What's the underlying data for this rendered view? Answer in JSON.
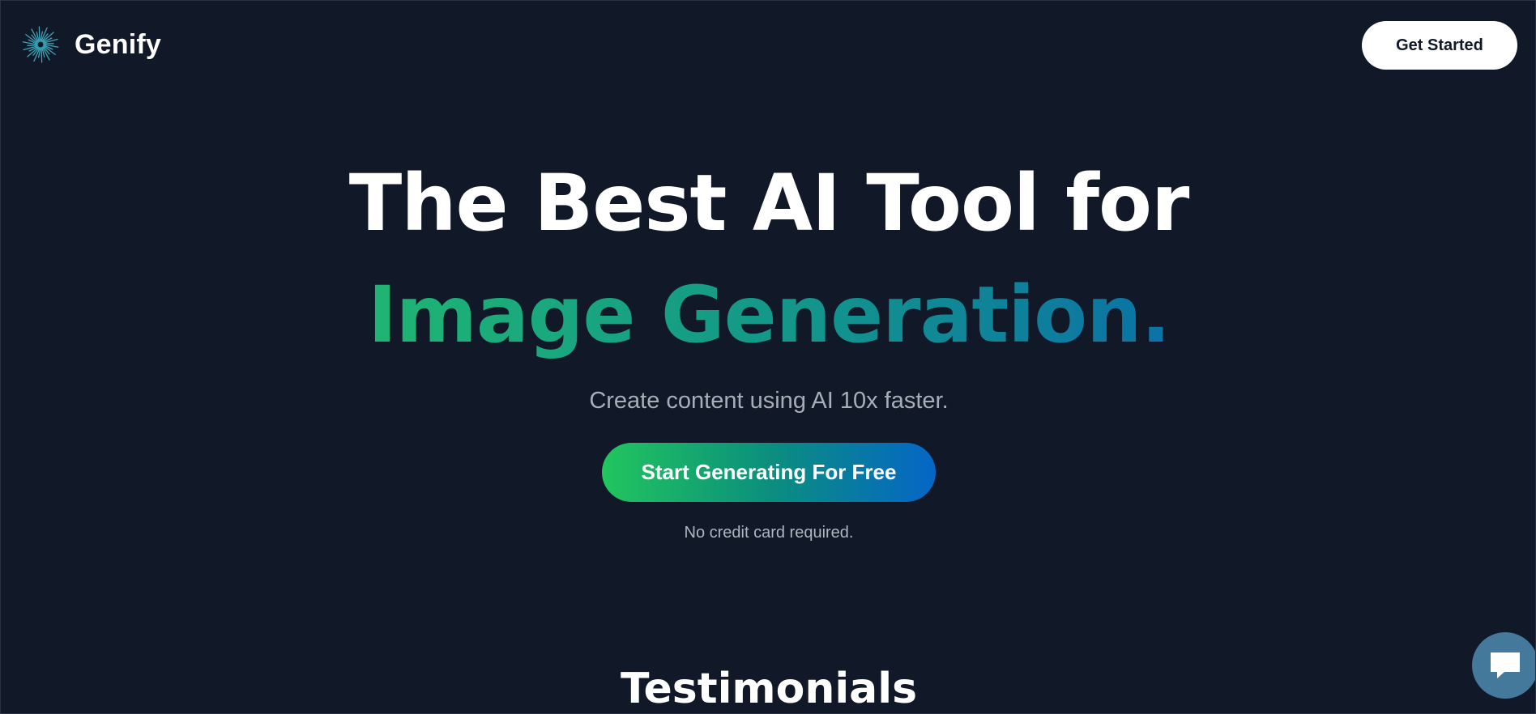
{
  "header": {
    "brand_name": "Genify",
    "logo_icon": "starburst-icon",
    "cta_label": "Get Started"
  },
  "hero": {
    "title_line_1": "The Best AI Tool for",
    "title_line_2": "Image Generation.",
    "subtitle": "Create content using AI 10x faster.",
    "cta_label": "Start Generating For Free",
    "note": "No credit card required."
  },
  "testimonials": {
    "heading": "Testimonials"
  },
  "chat_widget": {
    "icon": "chat-icon"
  },
  "colors": {
    "background": "#111827",
    "gradient_start": "#22c55e",
    "gradient_end": "#0566c7",
    "chat_bubble": "#45799b"
  }
}
